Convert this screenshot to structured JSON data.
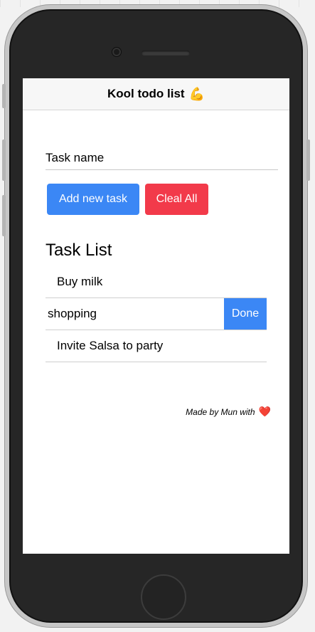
{
  "app": {
    "title": "Kool todo list",
    "title_emoji": "💪"
  },
  "form": {
    "task_placeholder": "Task name",
    "add_label": "Add new task",
    "clear_label": "Cleal All"
  },
  "task_list": {
    "heading": "Task List",
    "items": [
      {
        "label": "Buy milk"
      },
      {
        "label": "shopping",
        "action_label": "Done"
      },
      {
        "label": "Invite Salsa to party"
      }
    ]
  },
  "footer": {
    "text": "Made by Mun with",
    "heart": "❤️"
  },
  "colors": {
    "primary": "#3b87f5",
    "danger": "#f23a4a",
    "phone_body": "#262626"
  }
}
